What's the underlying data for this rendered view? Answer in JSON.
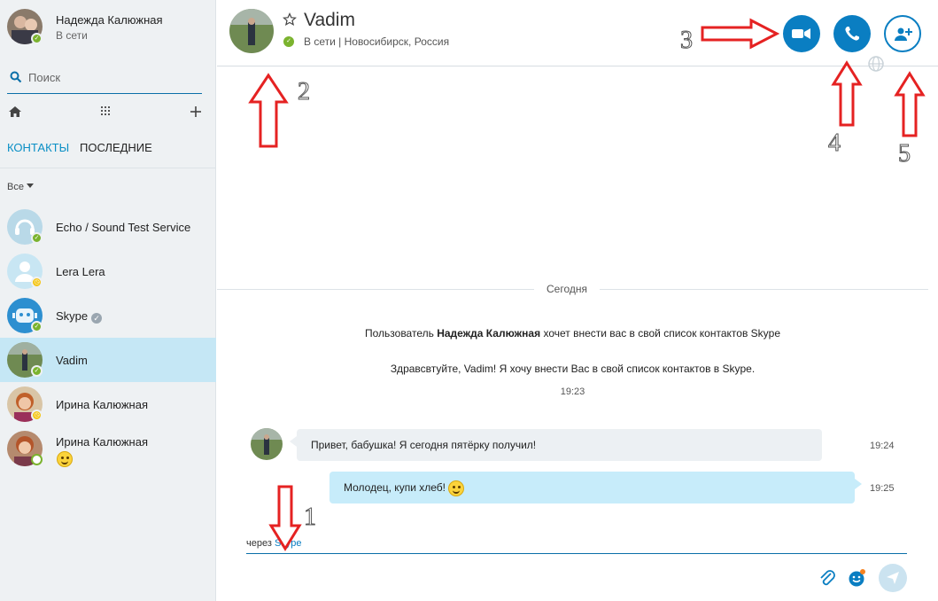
{
  "profile": {
    "name": "Надежда Калюжная",
    "status": "В сети"
  },
  "search": {
    "placeholder": "Поиск"
  },
  "tabs": {
    "contacts": "КОНТАКТЫ",
    "recent": "ПОСЛЕДНИЕ"
  },
  "filter": {
    "label": "Все"
  },
  "contacts": [
    {
      "name": "Echo / Sound Test Service",
      "status": "online"
    },
    {
      "name": "Lera Lera",
      "status": "away"
    },
    {
      "name": "Skype",
      "status": "online",
      "verified": true
    },
    {
      "name": "Vadim",
      "status": "online",
      "selected": true
    },
    {
      "name": "Ирина Калюжная",
      "status": "away"
    },
    {
      "name": "Ирина Калюжная",
      "status": "offline",
      "mood": "smiley-icon"
    }
  ],
  "header": {
    "name": "Vadim",
    "status": "В сети",
    "location": "Новосибирск, Россия",
    "status_line": "В сети | Новосибирск, Россия"
  },
  "chat": {
    "day_label": "Сегодня",
    "system_prefix": "Пользователь",
    "system_name": "Надежда Калюжная",
    "system_suffix": "хочет внести вас в свой список контактов Skype",
    "request_text": "Здравсвтуйте, Vadim! Я хочу внести Вас в свой список контактов в Skype.",
    "request_time": "19:23",
    "messages": [
      {
        "from": "Vadim",
        "text": "Привет, бабушка! Я сегодня пятёрку получил!",
        "time": "19:24"
      },
      {
        "from": "me",
        "text": "Молодец, купи хлеб!",
        "time": "19:25",
        "emoji": "smiley-icon"
      }
    ]
  },
  "compose": {
    "via_prefix": "через",
    "via_link": "Skype",
    "placeholder": ""
  },
  "annotations": [
    "1",
    "2",
    "3",
    "4",
    "5"
  ],
  "colors": {
    "accent": "#0a7ec2",
    "online": "#7bb32e",
    "away": "#f4c515",
    "selected_bg": "#c5e7f5",
    "arrow": "#e52222"
  }
}
